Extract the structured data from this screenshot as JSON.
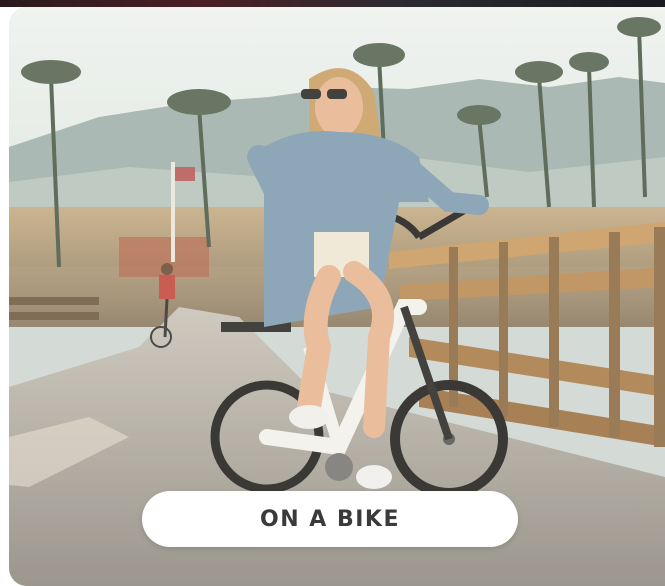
{
  "card": {
    "label": "ON A BIKE"
  },
  "colors": {
    "sky": "#dfe8e6",
    "hills": "#8fa3a0",
    "road": "#a8a49c",
    "fence": "#b98a55",
    "bike": "#f2f2f0",
    "jacket": "#7f9cb3",
    "pill": "#ffffff",
    "label_text": "#3a3a3a"
  }
}
